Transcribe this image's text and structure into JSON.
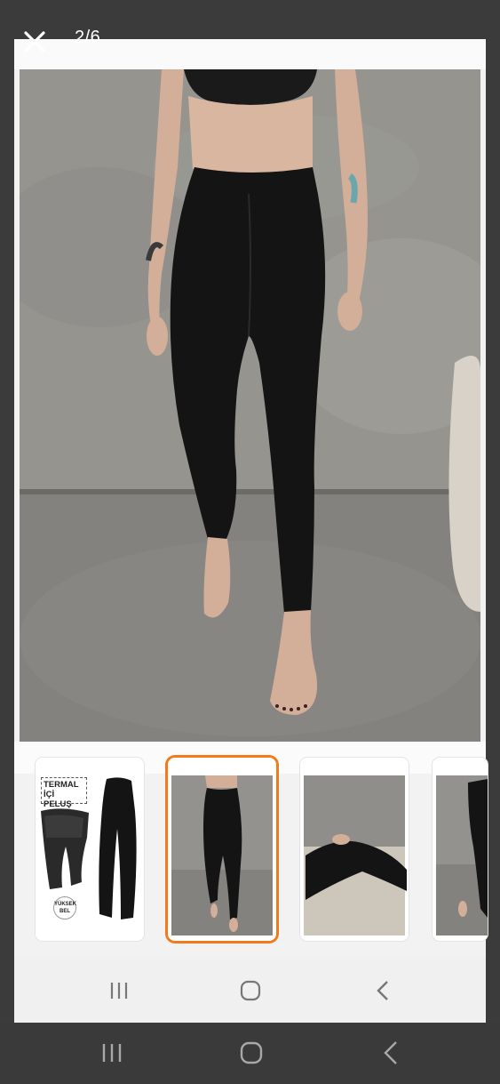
{
  "viewer": {
    "close_icon": "close-icon",
    "counter": "2/6"
  },
  "thumbnails": [
    {
      "label_title": "TERMAL",
      "label_sub": "İÇİ PELUŞ",
      "badge_top": "YÜKSEK",
      "badge_bottom": "BEL",
      "selected": false
    },
    {
      "selected": true
    },
    {
      "selected": false
    },
    {
      "selected": false
    }
  ],
  "nav": {
    "recents_icon": "recents-icon",
    "home_icon": "home-icon",
    "back_icon": "back-icon"
  },
  "colors": {
    "selected_border": "#f27a1a",
    "panel_bg": "#f2f2f2",
    "frame_bg": "#3a3a3a"
  }
}
